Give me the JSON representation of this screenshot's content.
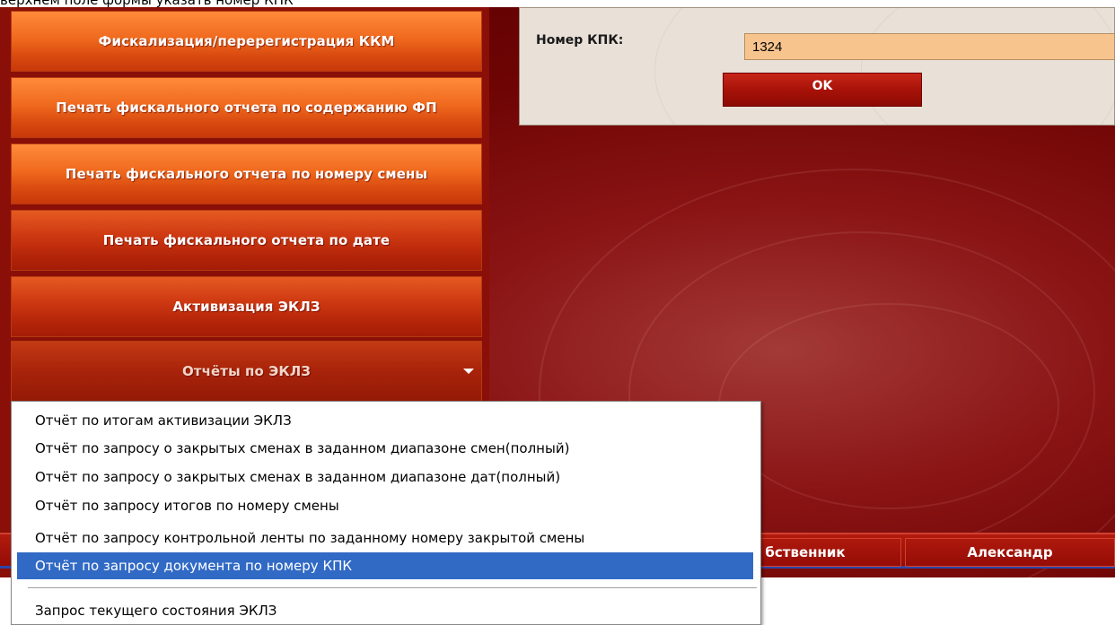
{
  "caption": {
    "text": "верхнем поле формы указать номер КПК"
  },
  "menu": {
    "buttons": [
      {
        "label": "Фискализация/перерегистрация ККМ"
      },
      {
        "label": "Печать фискального отчета по содержанию ФП"
      },
      {
        "label": "Печать фискального отчета по номеру смены"
      },
      {
        "label": "Печать фискального отчета по дате"
      },
      {
        "label": "Активизация ЭКЛЗ"
      },
      {
        "label": "Отчёты по ЭКЛЗ"
      }
    ]
  },
  "kpk_form": {
    "label": "Номер КПК:",
    "value": "1324",
    "ok_label": "OK"
  },
  "status_bar": {
    "cells": [
      {
        "text": "бственник"
      },
      {
        "text": "Александр"
      }
    ]
  },
  "dropdown": {
    "items": [
      {
        "label": "Отчёт по итогам активизации ЭКЛЗ",
        "selected": false
      },
      {
        "label": "Отчёт по запросу о закрытых сменах в заданном диапазоне смен(полный)",
        "selected": false
      },
      {
        "label": "Отчёт по запросу о закрытых сменах в заданном диапазоне дат(полный)",
        "selected": false
      },
      {
        "label": "Отчёт по запросу итогов по номеру смены",
        "selected": false
      },
      {
        "label": "Отчёт по запросу контрольной ленты по заданному номеру закрытой смены",
        "selected": false
      },
      {
        "label": "Отчёт по запросу документа по номеру КПК",
        "selected": true
      }
    ],
    "extra_items": [
      {
        "label": "Запрос текущего состояния ЭКЛЗ"
      }
    ]
  },
  "icons": {
    "dropdown_arrow": "chevron-down-icon"
  },
  "colors": {
    "accent_orange": "#f06a1e",
    "app_background": "#6e0404",
    "selection": "#316ac5",
    "input_background": "#f8c48e"
  }
}
